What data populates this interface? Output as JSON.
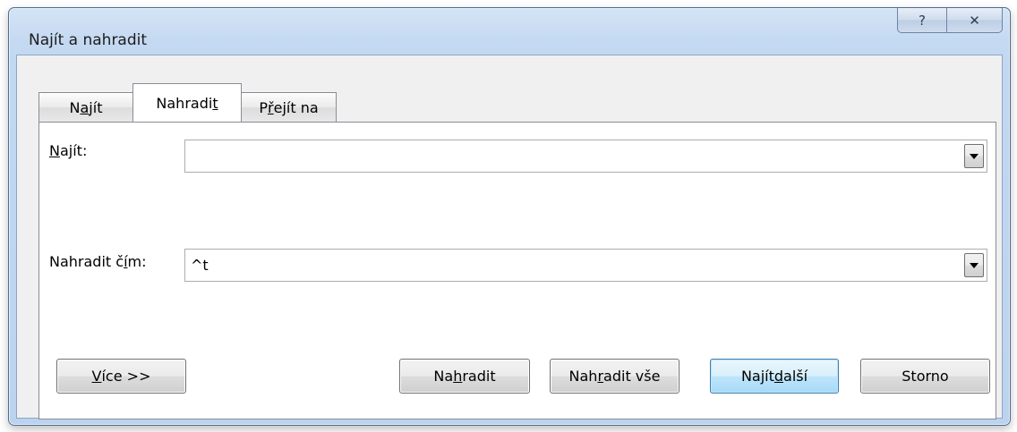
{
  "window": {
    "title": "Najít a nahradit",
    "help_glyph": "?",
    "close_glyph": "✕"
  },
  "tabs": [
    {
      "pre": "N",
      "ul": "a",
      "post": "jít"
    },
    {
      "pre": "Nahradi",
      "ul": "t",
      "post": ""
    },
    {
      "pre": "P",
      "ul": "ř",
      "post": "ejít na"
    }
  ],
  "active_tab_index": 1,
  "find": {
    "label_pre": "",
    "label_ul": "N",
    "label_post": "ajít:",
    "value": ""
  },
  "replace": {
    "label_pre": "Nahradit č",
    "label_ul": "í",
    "label_post": "m:",
    "value": "^t"
  },
  "buttons": {
    "more": {
      "pre": "",
      "ul": "V",
      "post": "íce >>"
    },
    "replace": {
      "pre": "Na",
      "ul": "h",
      "post": "radit"
    },
    "replace_all": {
      "pre": "Nah",
      "ul": "r",
      "post": "adit vše"
    },
    "find_next": {
      "pre": "Najít ",
      "ul": "d",
      "post": "alší"
    },
    "cancel": {
      "pre": "Storno",
      "ul": "",
      "post": ""
    }
  }
}
